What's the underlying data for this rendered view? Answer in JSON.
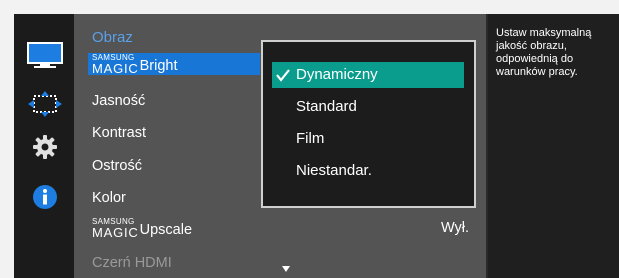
{
  "icons": {
    "picture": "monitor-icon",
    "position": "resize-arrows-icon",
    "settings": "gear-icon",
    "info": "info-icon"
  },
  "menu": {
    "title": "Obraz",
    "magic_prefix": "SAMSUNG",
    "magic_word": "MAGIC",
    "items": {
      "bright": "Bright",
      "brightness": "Jasność",
      "contrast": "Kontrast",
      "sharpness": "Ostrość",
      "color": "Kolor",
      "upscale": "Upscale",
      "upscale_value": "Wył.",
      "hdmi_black": "Czerń HDMI"
    }
  },
  "popup": {
    "options": [
      "Dynamiczny",
      "Standard",
      "Film",
      "Niestandar."
    ],
    "selected": "Dynamiczny"
  },
  "help": {
    "text": "Ustaw maksymalną jakość obrazu, odpowiednią do warunków pracy."
  },
  "colors": {
    "selection_blue": "#1877d6",
    "selected_option_teal": "#0a9c8d",
    "title_blue": "#5aa0e8",
    "info_blue": "#1e7de0"
  }
}
